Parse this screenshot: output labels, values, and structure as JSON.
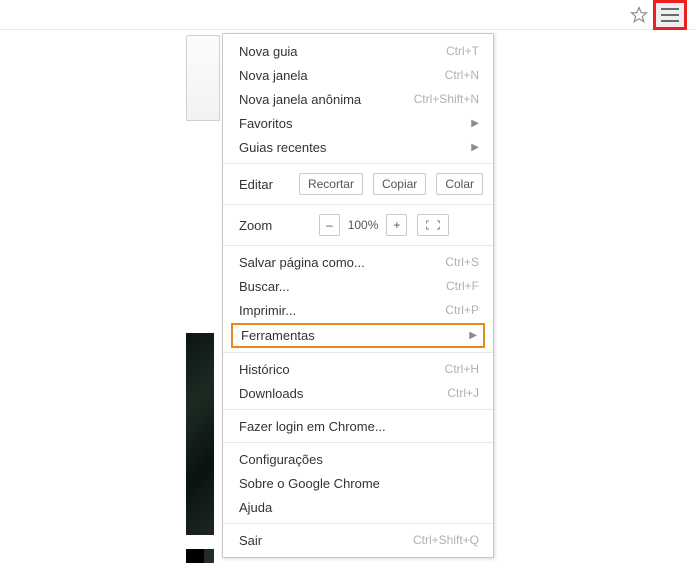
{
  "toolbar": {
    "star_name": "bookmark-star-icon",
    "menu_name": "main-menu-icon"
  },
  "menu": {
    "new_tab": {
      "label": "Nova guia",
      "shortcut": "Ctrl+T"
    },
    "new_window": {
      "label": "Nova janela",
      "shortcut": "Ctrl+N"
    },
    "incognito": {
      "label": "Nova janela anônima",
      "shortcut": "Ctrl+Shift+N"
    },
    "bookmarks": {
      "label": "Favoritos"
    },
    "recent_tabs": {
      "label": "Guias recentes"
    },
    "edit_label": "Editar",
    "cut": "Recortar",
    "copy": "Copiar",
    "paste": "Colar",
    "zoom_label": "Zoom",
    "zoom_minus": "–",
    "zoom_value": "100%",
    "zoom_plus": "+",
    "save_as": {
      "label": "Salvar página como...",
      "shortcut": "Ctrl+S"
    },
    "find": {
      "label": "Buscar...",
      "shortcut": "Ctrl+F"
    },
    "print": {
      "label": "Imprimir...",
      "shortcut": "Ctrl+P"
    },
    "tools": {
      "label": "Ferramentas"
    },
    "history": {
      "label": "Histórico",
      "shortcut": "Ctrl+H"
    },
    "downloads": {
      "label": "Downloads",
      "shortcut": "Ctrl+J"
    },
    "signin": {
      "label": "Fazer login em Chrome..."
    },
    "settings": {
      "label": "Configurações"
    },
    "about": {
      "label": "Sobre o Google Chrome"
    },
    "help": {
      "label": "Ajuda"
    },
    "exit": {
      "label": "Sair",
      "shortcut": "Ctrl+Shift+Q"
    }
  }
}
